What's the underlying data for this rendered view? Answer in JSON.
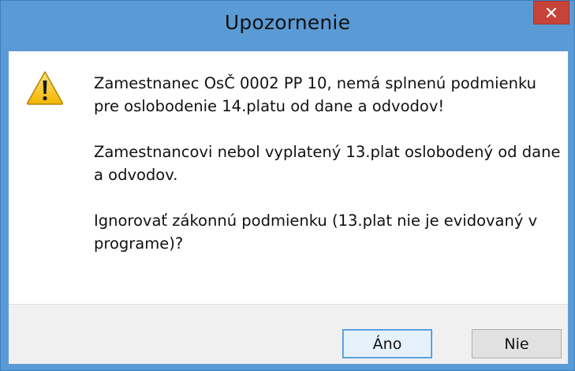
{
  "window": {
    "title": "Upozornenie",
    "close_icon": "close-icon"
  },
  "message": {
    "icon": "warning-icon",
    "paragraphs": [
      "Zamestnanec OsČ 0002 PP 10, nemá splnenú podmienku pre oslobodenie 14.platu od dane a odvodov!",
      "Zamestnancovi nebol vyplatený 13.plat oslobodený od dane a odvodov.",
      "Ignorovať zákonnú podmienku (13.plat nie je evidovaný v programe)?"
    ]
  },
  "buttons": {
    "yes_label": "Áno",
    "no_label": "Nie"
  },
  "colors": {
    "titlebar": "#5b9bd5",
    "close_button": "#c7433a",
    "content_bg": "#ffffff",
    "buttonbar_bg": "#f0f0f0",
    "default_button_border": "#3c8ed8"
  }
}
